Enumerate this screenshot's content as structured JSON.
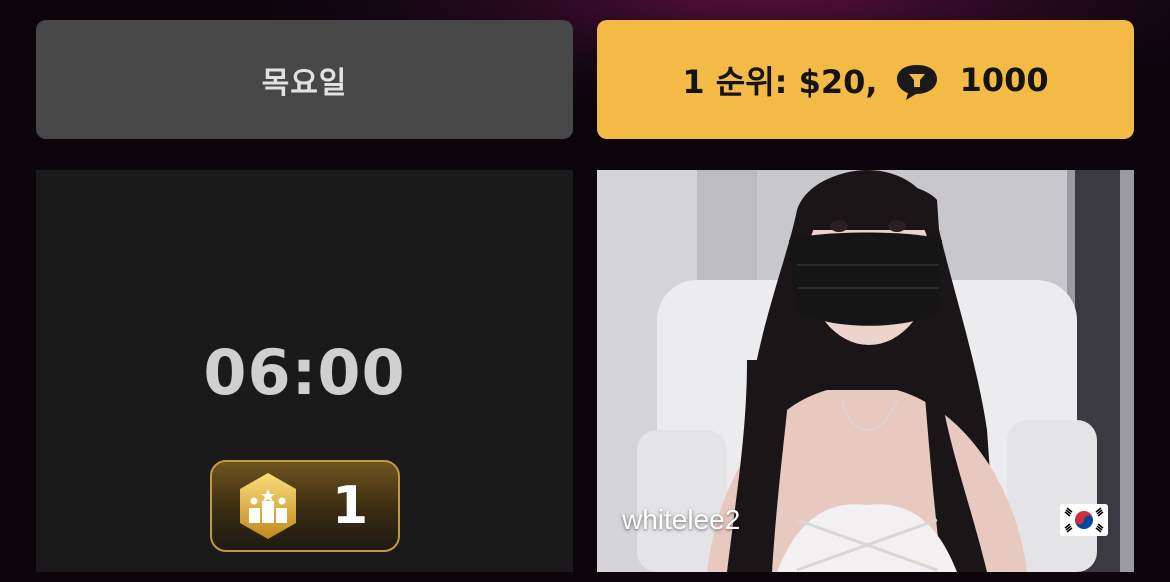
{
  "day_panel": {
    "label": "목요일"
  },
  "prize_panel": {
    "rank_text": "1 순위: $20,",
    "coin_icon": "coin-chat-icon",
    "coin_amount": "1000",
    "accent_color": "#f3ba45"
  },
  "timer_panel": {
    "time": "06:00",
    "rank_badge": {
      "icon": "rank-trophy-icon",
      "value": "1"
    }
  },
  "stream_panel": {
    "username": "whitelee2",
    "flag_icon": "south-korea-flag-icon"
  }
}
